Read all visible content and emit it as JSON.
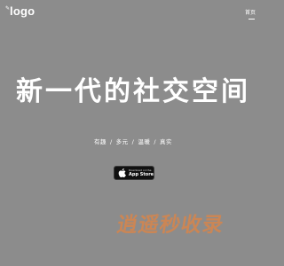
{
  "header": {
    "logo_mark": "✎",
    "logo_text": "logo",
    "nav_home": "首页"
  },
  "hero": {
    "title": "新一代的社交空间",
    "tagline": [
      "有趣",
      "多元",
      "温暖",
      "真实"
    ],
    "separator": "/"
  },
  "appstore": {
    "small_label": "Download on the",
    "big_label": "App Store",
    "icon": "apple-icon"
  },
  "watermark": {
    "text": "逍遥秒收录"
  },
  "colors": {
    "background": "#8c8c8c",
    "text": "#ffffff",
    "badge": "#111111",
    "watermark": "#ff8228"
  }
}
